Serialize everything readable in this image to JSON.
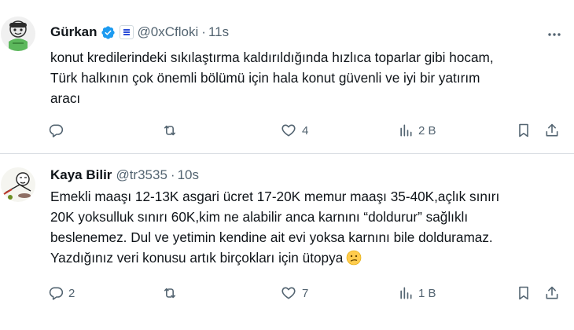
{
  "tweets": [
    {
      "name": "Gürkan",
      "handle": "@0xCfloki",
      "separator": "·",
      "time": "11s",
      "lines": [
        "konut kredilerindeki sıkılaştırma kaldırıldığında hızlıca toparlar gibi hocam,",
        "Türk halkının çok önemli bölümü için hala konut güvenli ve iyi bir yatırım",
        "aracı"
      ],
      "replies": "",
      "reposts": "",
      "likes": "4",
      "views": "2 B"
    },
    {
      "name": "Kaya Bilir",
      "handle": "@tr3535",
      "separator": "·",
      "time": "10s",
      "lines": [
        "Emekli maaşı 12-13K asgari ücret 17-20K memur maaşı 35-40K,açlık sınırı",
        "20K yoksulluk sınırı 60K,kim ne alabilir anca karnını “doldurur” sağlıklı",
        "beslenemez. Dul ve yetimin kendine ait evi yoksa karnını bile dolduramaz.",
        "Yazdığınız veri konusu artık birçokları için ütopya"
      ],
      "emoji": "confused-face",
      "replies": "2",
      "reposts": "",
      "likes": "7",
      "views": "1 B"
    }
  ],
  "colors": {
    "text": "#0f1419",
    "secondary": "#536471",
    "verified": "#1d9bf0",
    "divider": "#d9dee3",
    "affiliate": "#2a4cd7"
  },
  "icons": {
    "reply": "reply-icon",
    "repost": "repost-icon",
    "like": "heart-icon",
    "views": "views-icon",
    "bookmark": "bookmark-icon",
    "share": "share-icon",
    "more": "more-icon",
    "verified": "verified-badge-icon"
  }
}
